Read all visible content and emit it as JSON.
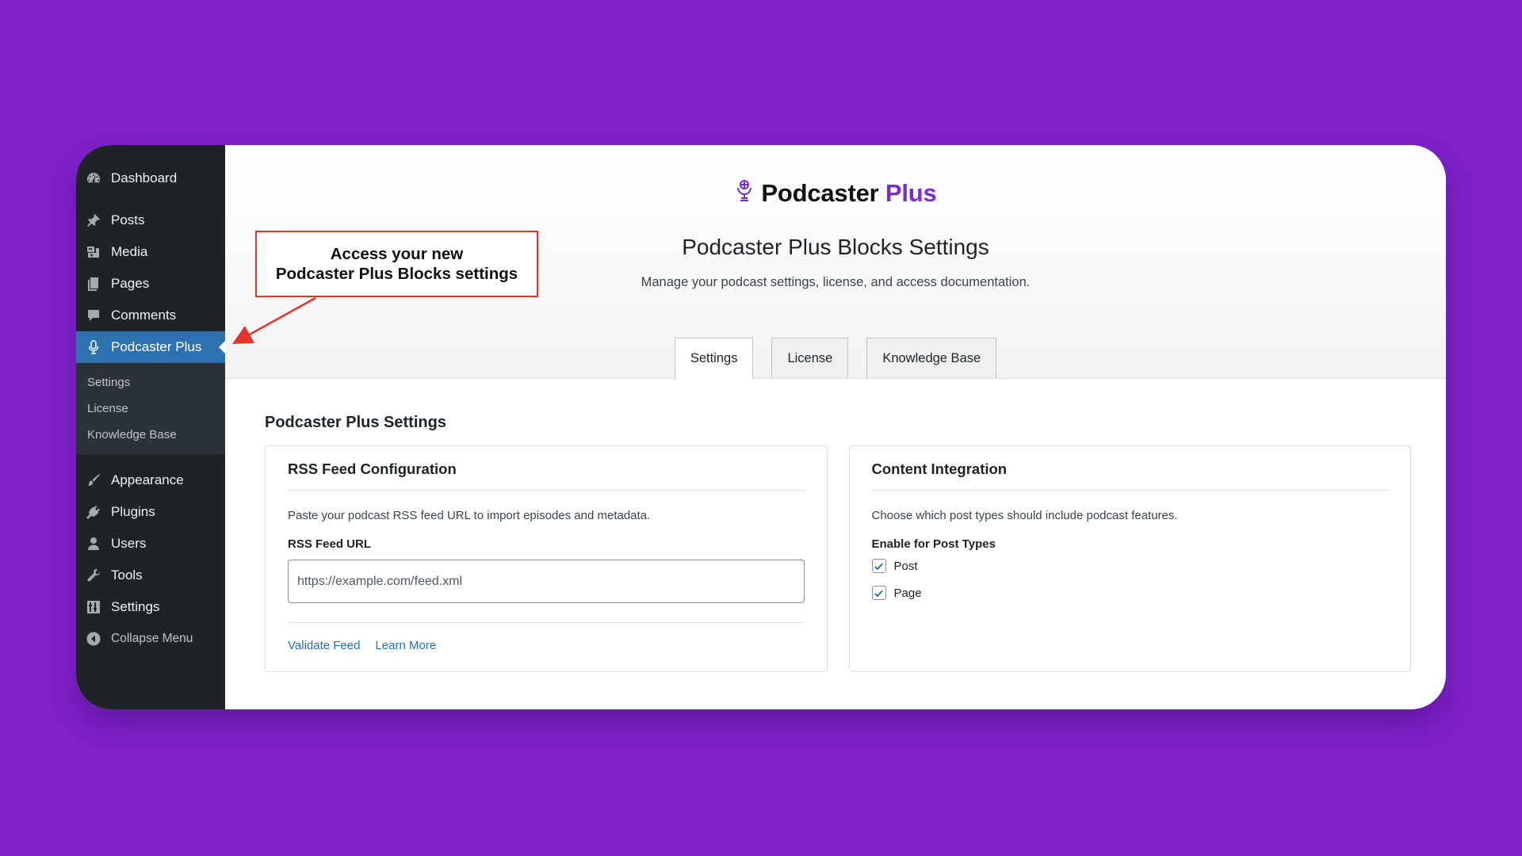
{
  "sidebar": {
    "items": [
      {
        "label": "Dashboard",
        "icon": "dashboard-icon"
      },
      {
        "label": "Posts",
        "icon": "pin-icon"
      },
      {
        "label": "Media",
        "icon": "media-icon"
      },
      {
        "label": "Pages",
        "icon": "pages-icon"
      },
      {
        "label": "Comments",
        "icon": "comment-icon"
      },
      {
        "label": "Podcaster Plus",
        "icon": "microphone-icon",
        "active": true
      },
      {
        "label": "Appearance",
        "icon": "brush-icon"
      },
      {
        "label": "Plugins",
        "icon": "plug-icon"
      },
      {
        "label": "Users",
        "icon": "user-icon"
      },
      {
        "label": "Tools",
        "icon": "wrench-icon"
      },
      {
        "label": "Settings",
        "icon": "sliders-icon"
      },
      {
        "label": "Collapse Menu",
        "icon": "collapse-icon"
      }
    ],
    "submenu": [
      "Settings",
      "License",
      "Knowledge Base"
    ]
  },
  "brand": {
    "name_main": "Podcaster",
    "name_accent": "Plus",
    "accent_color": "#7B2BD0"
  },
  "header": {
    "title": "Podcaster Plus Blocks Settings",
    "subtitle": "Manage your podcast settings, license, and access documentation."
  },
  "tabs": [
    "Settings",
    "License",
    "Knowledge Base"
  ],
  "callout": {
    "line1": "Access your new",
    "line2": "Podcaster Plus Blocks settings",
    "color": "#E8332A"
  },
  "section_title": "Podcaster Plus Settings",
  "rss_card": {
    "title": "RSS Feed Configuration",
    "description": "Paste your podcast RSS feed URL to import episodes and metadata.",
    "field_label": "RSS Feed URL",
    "placeholder": "https://example.com/feed.xml",
    "value": "",
    "links": [
      "Validate Feed",
      "Learn More"
    ]
  },
  "content_card": {
    "title": "Content Integration",
    "description": "Choose which post types should include podcast features.",
    "field_label": "Enable for Post Types",
    "options": [
      {
        "label": "Post",
        "checked": true
      },
      {
        "label": "Page",
        "checked": true
      }
    ]
  },
  "colors": {
    "background": "#8021CC",
    "sidebar": "#1E2327",
    "active_menu": "#2E71B1",
    "link": "#2271b1"
  }
}
